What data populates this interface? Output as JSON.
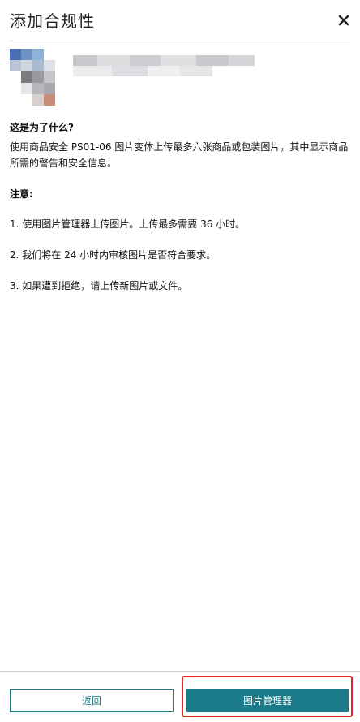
{
  "header": {
    "title": "添加合规性",
    "close_icon": "close-icon"
  },
  "content": {
    "question": "这是为了什么?",
    "description": "使用商品安全 PS01-06 图片变体上传最多六张商品或包装图片，其中显示商品所需的警告和安全信息。",
    "note_heading": "注意:",
    "steps": [
      "1. 使用图片管理器上传图片。上传最多需要 36 小时。",
      "2. 我们将在 24 小时内审核图片是否符合要求。",
      "3. 如果遭到拒绝，请上传新图片或文件。"
    ]
  },
  "footer": {
    "back_label": "返回",
    "primary_label": "图片管理器"
  },
  "colors": {
    "accent": "#1a7a8a",
    "highlight": "#e3262b"
  }
}
